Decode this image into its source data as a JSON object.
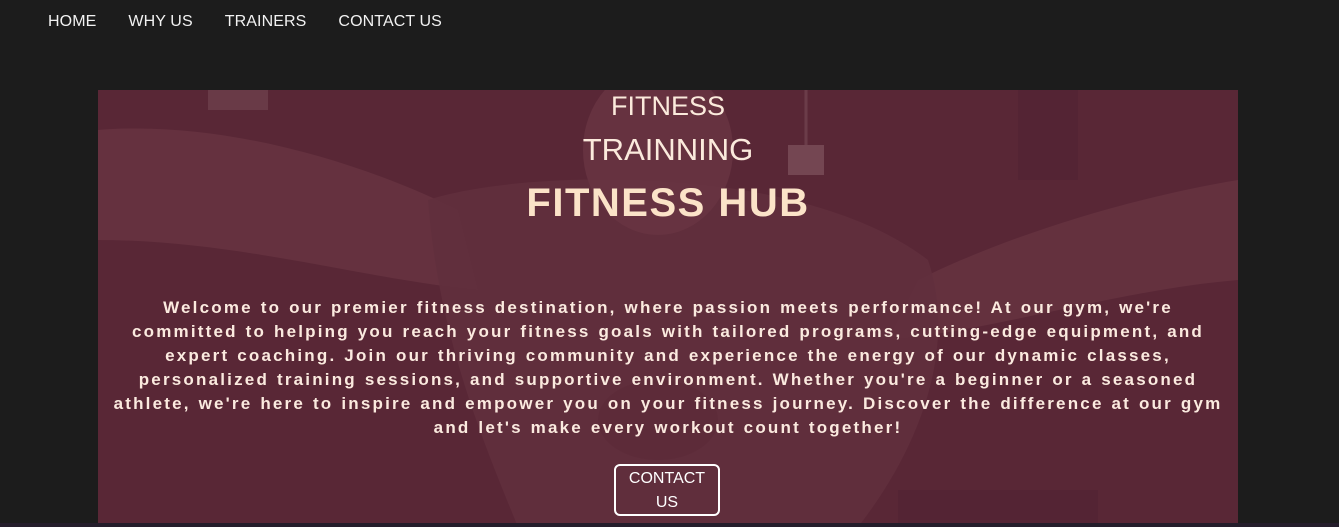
{
  "nav": {
    "items": [
      "HOME",
      "WHY US",
      "TRAINERS",
      "CONTACT US"
    ]
  },
  "hero": {
    "subtitle_1": "FITNESS",
    "subtitle_2": "TRAINNING",
    "title": "FITNESS HUB",
    "description": "Welcome to our premier fitness destination, where passion meets performance! At our gym, we're committed to helping you reach your fitness goals with tailored programs, cutting-edge equipment, and expert coaching. Join our thriving community and experience the energy of our dynamic classes, personalized training sessions, and supportive environment. Whether you're a beginner or a seasoned athlete, we're here to inspire and empower you on your fitness journey. Discover the difference at our gym and let's make every workout count together!",
    "cta_label": "CONTACT US"
  },
  "colors": {
    "page_background": "#1c1c1c",
    "hero_overlay": "#5a2a37",
    "title_color": "#fbe3c8",
    "nav_text": "#f2f2f2"
  }
}
